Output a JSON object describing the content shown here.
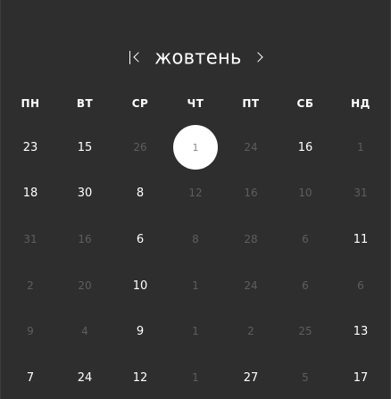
{
  "calendar": {
    "month": "жовтень",
    "prev_label": "",
    "next_label": "",
    "weekdays": [
      "ПН",
      "ВТ",
      "СР",
      "ЧТ",
      "ПТ",
      "СБ",
      "НД"
    ],
    "weeks": [
      [
        {
          "label": "23",
          "muted": false
        },
        {
          "label": "15",
          "muted": false
        },
        {
          "label": "26",
          "muted": true
        },
        {
          "label": "1",
          "muted": false,
          "selected": true
        },
        {
          "label": "24",
          "muted": true
        },
        {
          "label": "16",
          "muted": false
        },
        {
          "label": "1",
          "muted": true
        }
      ],
      [
        {
          "label": "18",
          "muted": false
        },
        {
          "label": "30",
          "muted": false
        },
        {
          "label": "8",
          "muted": false
        },
        {
          "label": "12",
          "muted": true
        },
        {
          "label": "16",
          "muted": true
        },
        {
          "label": "10",
          "muted": true
        },
        {
          "label": "31",
          "muted": true
        }
      ],
      [
        {
          "label": "31",
          "muted": true
        },
        {
          "label": "16",
          "muted": true
        },
        {
          "label": "6",
          "muted": false
        },
        {
          "label": "8",
          "muted": true
        },
        {
          "label": "28",
          "muted": true
        },
        {
          "label": "6",
          "muted": true
        },
        {
          "label": "11",
          "muted": false
        }
      ],
      [
        {
          "label": "2",
          "muted": true
        },
        {
          "label": "20",
          "muted": true
        },
        {
          "label": "10",
          "muted": false
        },
        {
          "label": "1",
          "muted": true
        },
        {
          "label": "24",
          "muted": true
        },
        {
          "label": "6",
          "muted": true
        },
        {
          "label": "6",
          "muted": true
        }
      ],
      [
        {
          "label": "9",
          "muted": true
        },
        {
          "label": "4",
          "muted": true
        },
        {
          "label": "9",
          "muted": false
        },
        {
          "label": "1",
          "muted": true
        },
        {
          "label": "2",
          "muted": true
        },
        {
          "label": "25",
          "muted": true
        },
        {
          "label": "13",
          "muted": false
        }
      ],
      [
        {
          "label": "7",
          "muted": false
        },
        {
          "label": "24",
          "muted": false
        },
        {
          "label": "12",
          "muted": false
        },
        {
          "label": "1",
          "muted": true
        },
        {
          "label": "27",
          "muted": false
        },
        {
          "label": "5",
          "muted": true
        },
        {
          "label": "17",
          "muted": false
        }
      ]
    ]
  },
  "colors": {
    "background": "#2e2e2e",
    "text": "#ffffff",
    "muted_text": "#5e5e5e",
    "selected_background": "#ffffff",
    "selected_text": "#8a8a8a"
  },
  "icons": {
    "prev": "chevron-left-bar-icon",
    "next": "chevron-right-icon"
  }
}
